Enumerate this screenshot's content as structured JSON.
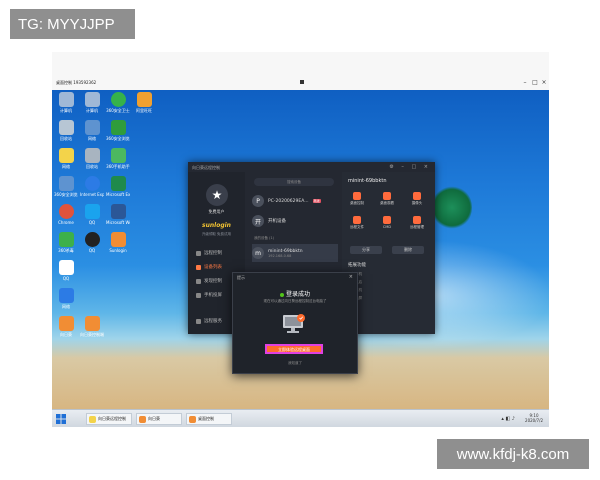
{
  "watermarks": {
    "top": "TG: MYYJJPP",
    "bottom": "www.kfdj-k8.com"
  },
  "remote_window": {
    "title": "桌面控制 193592362"
  },
  "desktop_icons": [
    {
      "label": "计算机",
      "color": "#9fb8d6"
    },
    {
      "label": "回收站",
      "color": "#b7c6d4"
    },
    {
      "label": "360安全卫士",
      "color": "#36b24a"
    },
    {
      "label": "阿里旺旺",
      "color": "#f0a030"
    },
    {
      "label": "网络",
      "color": "#5e93d0"
    },
    {
      "label": "360安全浏览器",
      "color": "#2f9c3c"
    },
    {
      "label": "360手机助手",
      "color": "#4cb860"
    },
    {
      "label": "回收站",
      "color": "#a8b4c0"
    },
    {
      "label": "Chrome",
      "color": "#e0533c"
    },
    {
      "label": "Internet Explorer",
      "color": "#2c7be5"
    },
    {
      "label": "Microsoft Excel",
      "color": "#1f8a4c"
    },
    {
      "label": "Microsoft Word",
      "color": "#2b5797"
    },
    {
      "label": "360杀毒",
      "color": "#3db04a"
    },
    {
      "label": "QQ",
      "color": "#1aa3ee"
    },
    {
      "label": "Sunlogin",
      "color": "#f18d34"
    },
    {
      "label": "向日葵",
      "color": "#f18d34"
    },
    {
      "label": "向日葵控制端",
      "color": "#f18d34"
    }
  ],
  "app": {
    "title": "向日葵远程控制",
    "user": {
      "name": "免费用户",
      "logo": "sunlogin",
      "sub": "升级领取 免费试用"
    },
    "sidebar": [
      {
        "label": "远程控制",
        "active": false
      },
      {
        "label": "设备列表",
        "active": true
      },
      {
        "label": "发现控制",
        "active": false
      },
      {
        "label": "手机投屏",
        "active": false
      },
      {
        "label": "远程服务",
        "active": false
      }
    ],
    "search_placeholder": "搜索设备",
    "devices": [
      {
        "initial": "P",
        "name": "PC-20200629EA...",
        "tag": "离线"
      },
      {
        "initial": "开",
        "name": "开机设备"
      }
    ],
    "group_label": "我的设备 (1)",
    "selected_device": {
      "initial": "m",
      "name": "minint-69bbktn",
      "sub": "192.168.0.68"
    },
    "detail": {
      "title": "minint-69bbktn",
      "functions": [
        "桌面控制",
        "桌面观看",
        "摄像头",
        "远程文件",
        "CMD",
        "远程管理"
      ],
      "buttons": [
        "分享",
        "删除"
      ],
      "ext_title": "拓展功能",
      "ext_items": [
        "远程开机",
        "远程重启",
        "远程关机",
        "远程锁屏"
      ]
    }
  },
  "dialog": {
    "title": "提示",
    "close": "×",
    "success": "登录成功",
    "desc": "现在可以通过向日葵远程控制这台电脑了",
    "button": "立即体验远程桌面",
    "link": "我知道了"
  },
  "taskbar": {
    "tasks": [
      "向日葵远程控制",
      "向日葵",
      "桌面控制"
    ],
    "clock_time": "9:10",
    "clock_date": "2020/7/2"
  }
}
